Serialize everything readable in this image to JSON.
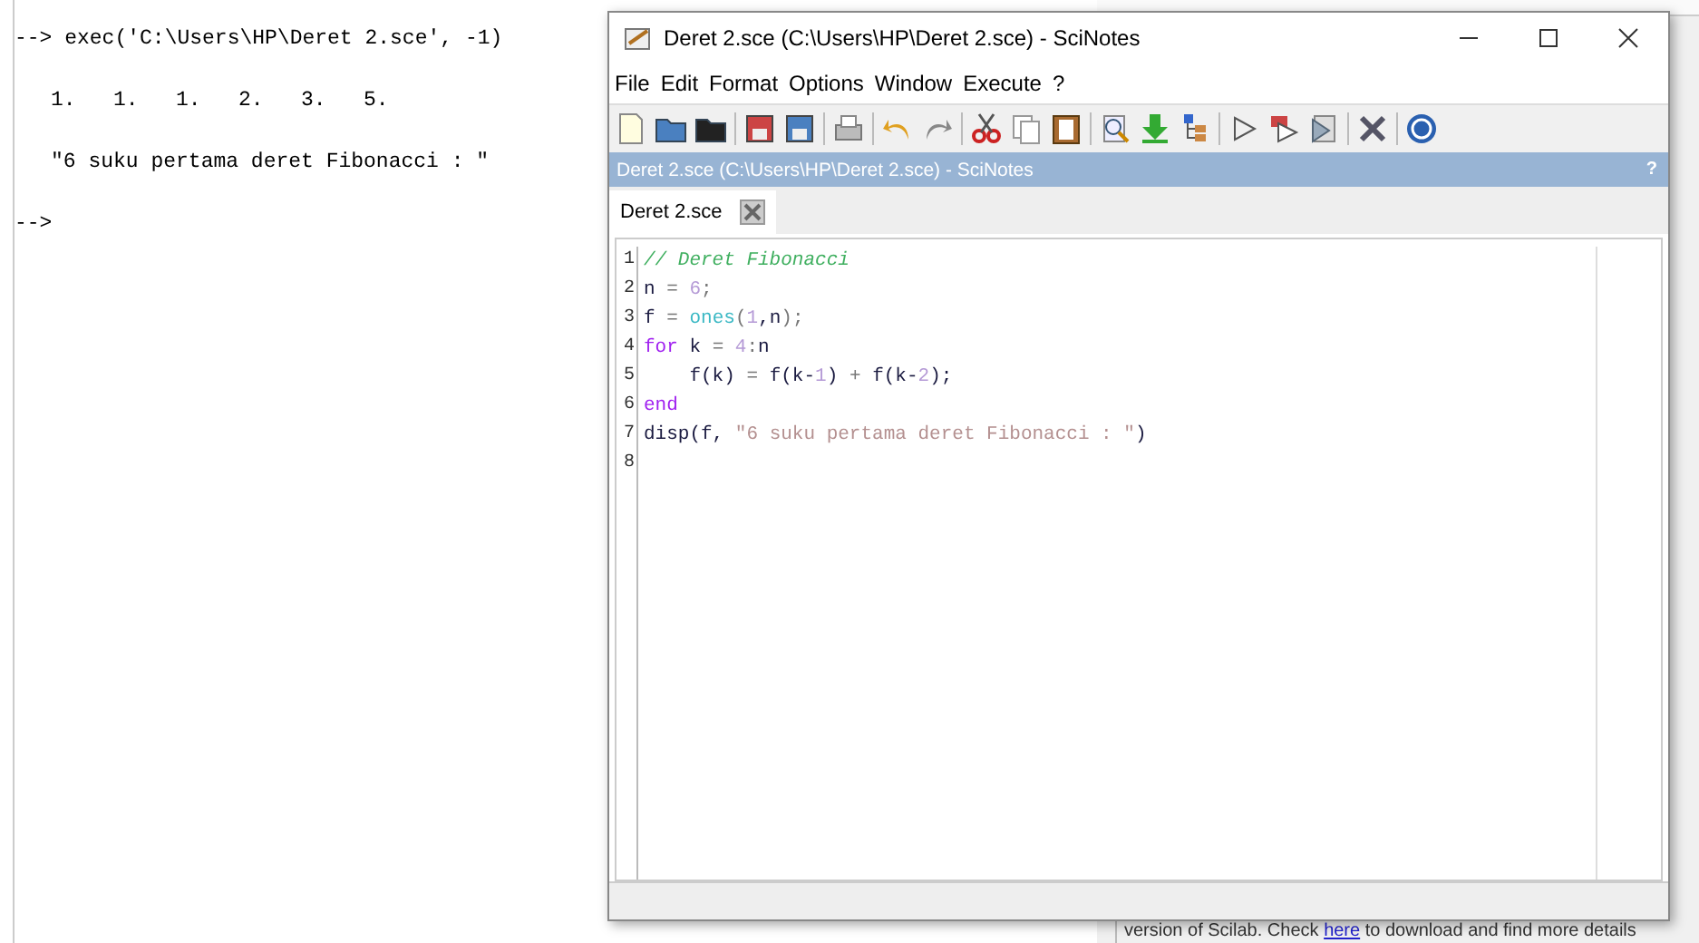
{
  "console": {
    "lines": [
      {
        "kind": "prompt",
        "text": "--> exec('C:\\Users\\HP\\Deret 2.sce', -1)"
      },
      {
        "kind": "output",
        "text": "1.   1.   1.   2.   3.   5."
      },
      {
        "kind": "output",
        "text": "\"6 suku pertama deret Fibonacci : \""
      },
      {
        "kind": "prompt",
        "text": "-->"
      }
    ]
  },
  "window": {
    "title": "Deret 2.sce (C:\\Users\\HP\\Deret 2.sce) - SciNotes",
    "menu": [
      "File",
      "Edit",
      "Format",
      "Options",
      "Window",
      "Execute",
      "?"
    ],
    "panel_title": "Deret 2.sce (C:\\Users\\HP\\Deret 2.sce) - SciNotes",
    "panel_help": "?",
    "tabs": [
      {
        "label": "Deret 2.sce",
        "selected": true
      }
    ],
    "code": [
      {
        "number": "1",
        "tokens": [
          {
            "kind": "comment",
            "text": "// Deret Fibonacci"
          }
        ]
      },
      {
        "number": "2",
        "tokens": [
          {
            "kind": "plain",
            "text": "n"
          },
          {
            "kind": "op",
            "text": " = "
          },
          {
            "kind": "number",
            "text": "6"
          },
          {
            "kind": "op",
            "text": ";"
          }
        ]
      },
      {
        "number": "3",
        "tokens": [
          {
            "kind": "plain",
            "text": "f"
          },
          {
            "kind": "op",
            "text": " = "
          },
          {
            "kind": "func",
            "text": "ones"
          },
          {
            "kind": "op",
            "text": "("
          },
          {
            "kind": "number",
            "text": "1"
          },
          {
            "kind": "plain",
            "text": ",n"
          },
          {
            "kind": "op",
            "text": ");"
          }
        ]
      },
      {
        "number": "4",
        "tokens": [
          {
            "kind": "keyword",
            "text": "for"
          },
          {
            "kind": "plain",
            "text": " k"
          },
          {
            "kind": "op",
            "text": " = "
          },
          {
            "kind": "number",
            "text": "4"
          },
          {
            "kind": "op",
            "text": ":"
          },
          {
            "kind": "plain",
            "text": "n"
          }
        ]
      },
      {
        "number": "5",
        "tokens": [
          {
            "kind": "plain",
            "text": "    f(k)"
          },
          {
            "kind": "op",
            "text": " = "
          },
          {
            "kind": "plain",
            "text": "f(k-"
          },
          {
            "kind": "number",
            "text": "1"
          },
          {
            "kind": "plain",
            "text": ")"
          },
          {
            "kind": "op",
            "text": " + "
          },
          {
            "kind": "plain",
            "text": "f(k-"
          },
          {
            "kind": "number",
            "text": "2"
          },
          {
            "kind": "plain",
            "text": ");"
          }
        ]
      },
      {
        "number": "6",
        "tokens": [
          {
            "kind": "keyword",
            "text": "end"
          }
        ]
      },
      {
        "number": "7",
        "tokens": [
          {
            "kind": "plain",
            "text": "disp(f, "
          },
          {
            "kind": "string",
            "text": "\"6 suku pertama deret Fibonacci : \""
          },
          {
            "kind": "plain",
            "text": ")"
          }
        ]
      },
      {
        "number": "8"
      }
    ]
  },
  "background_notice": {
    "text": "version of Scilab. Check ",
    "link": "here",
    "rest": " to download and find more details"
  }
}
